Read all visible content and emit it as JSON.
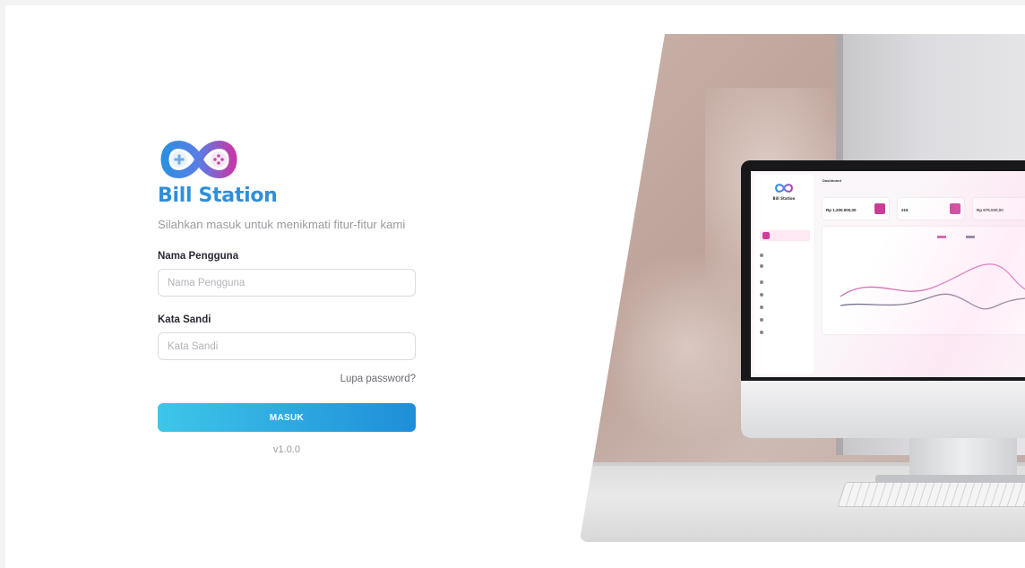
{
  "login": {
    "brand": "Bill Station",
    "subtitle": "Silahkan masuk untuk menikmati fitur-fitur kami",
    "username": {
      "label": "Nama Pengguna",
      "placeholder": "Nama Pengguna",
      "value": ""
    },
    "password": {
      "label": "Kata Sandi",
      "placeholder": "Kata Sandi",
      "value": ""
    },
    "forgot_password": "Lupa password?",
    "submit": "MASUK",
    "version": "v1.0.0"
  },
  "colors": {
    "brand_blue": "#2f8fd9",
    "brand_purple": "#c23aa8",
    "button_gradient_start": "#3ec6e9",
    "button_gradient_end": "#1e8ed8"
  },
  "hero": {
    "image": "desktop-monitor-on-desk-showing-dashboard",
    "screen": {
      "brand": "Bill Station",
      "page_title": "Dashboard",
      "cards": [
        {
          "value": "Rp 1.200.000,00"
        },
        {
          "value": "215"
        },
        {
          "value": "Rp 675.000,00"
        }
      ]
    }
  }
}
